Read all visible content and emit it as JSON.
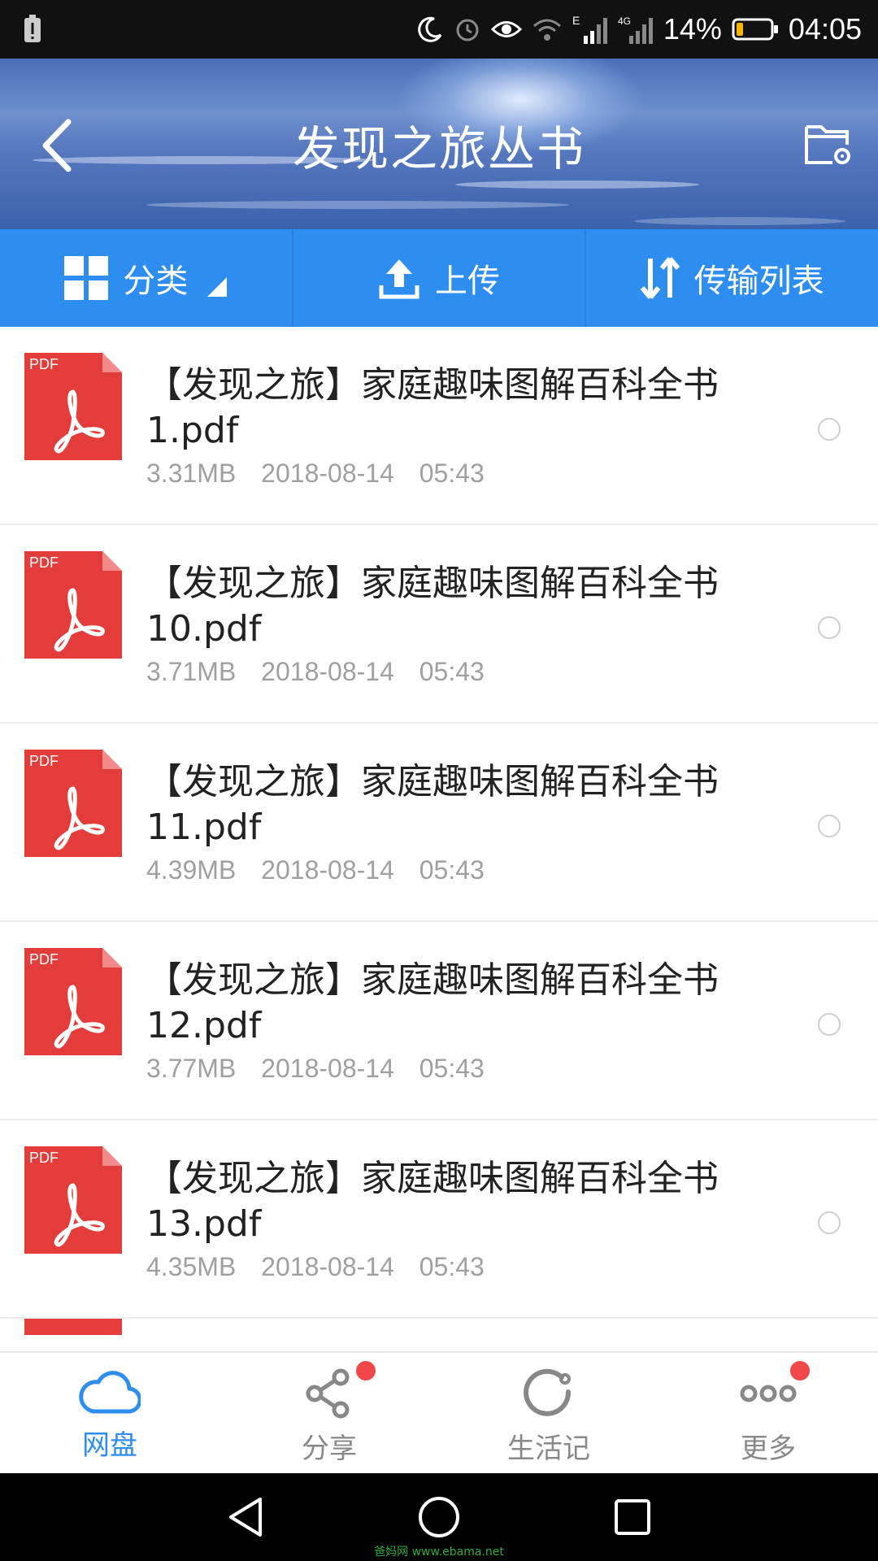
{
  "status_bar": {
    "battery_percent": "14%",
    "time": "04:05",
    "network_e": "E",
    "network_4g": "4G",
    "icons": [
      "battery-alert-icon",
      "moon-icon",
      "alarm-icon",
      "eye-icon",
      "wifi-icon",
      "signal-icon",
      "signal-icon",
      "battery-icon"
    ]
  },
  "header": {
    "title": "发现之旅丛书",
    "back_icon": "chevron-left-icon",
    "settings_icon": "folder-settings-icon"
  },
  "toolbar": {
    "category_label": "分类",
    "upload_label": "上传",
    "transfer_label": "传输列表"
  },
  "files": [
    {
      "name": "【发现之旅】家庭趣味图解百科全书1.pdf",
      "size": "3.31MB",
      "date": "2018-08-14",
      "time": "05:43",
      "type_label": "PDF"
    },
    {
      "name": "【发现之旅】家庭趣味图解百科全书10.pdf",
      "size": "3.71MB",
      "date": "2018-08-14",
      "time": "05:43",
      "type_label": "PDF"
    },
    {
      "name": "【发现之旅】家庭趣味图解百科全书11.pdf",
      "size": "4.39MB",
      "date": "2018-08-14",
      "time": "05:43",
      "type_label": "PDF"
    },
    {
      "name": "【发现之旅】家庭趣味图解百科全书12.pdf",
      "size": "3.77MB",
      "date": "2018-08-14",
      "time": "05:43",
      "type_label": "PDF"
    },
    {
      "name": "【发现之旅】家庭趣味图解百科全书13.pdf",
      "size": "4.35MB",
      "date": "2018-08-14",
      "time": "05:43",
      "type_label": "PDF"
    }
  ],
  "bottom_nav": {
    "items": [
      {
        "label": "网盘",
        "icon": "cloud-icon",
        "active": true
      },
      {
        "label": "分享",
        "icon": "share-icon",
        "badge": true
      },
      {
        "label": "生活记",
        "icon": "circle-arrow-icon"
      },
      {
        "label": "更多",
        "icon": "more-dots-icon",
        "badge": true
      }
    ]
  },
  "colors": {
    "accent": "#2e8ef0",
    "pdf_red": "#e43b3b",
    "badge_red": "#f04848"
  },
  "watermark": "爸妈网 www.ebama.net"
}
